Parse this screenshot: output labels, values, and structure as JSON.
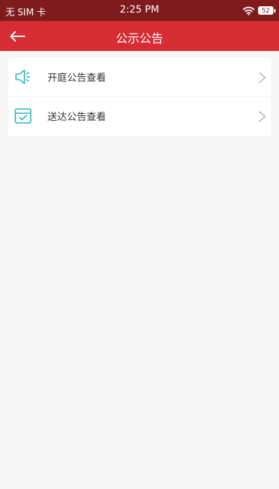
{
  "status_bar": {
    "carrier": "无 SIM 卡",
    "time": "2:25 PM",
    "battery": "52"
  },
  "header": {
    "title": "公示公告"
  },
  "menu": {
    "items": [
      {
        "label": "开庭公告查看",
        "icon": "speaker-icon"
      },
      {
        "label": "送达公告查看",
        "icon": "inbox-check-icon"
      }
    ]
  },
  "colors": {
    "status_bar": "#7f1b1d",
    "header": "#d52d33",
    "icon_accent": "#2bb3b3",
    "background": "#f6f6f6"
  }
}
